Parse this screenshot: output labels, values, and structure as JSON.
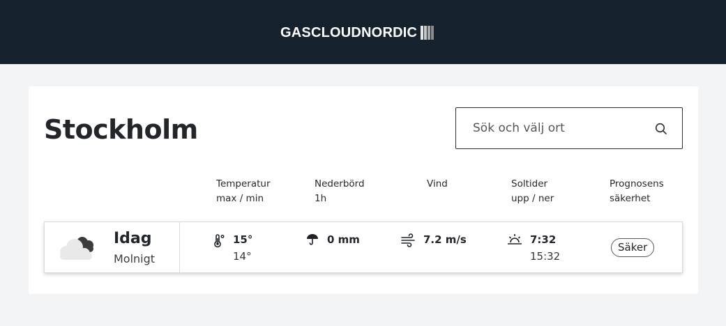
{
  "header": {
    "logo_text": "GASCLOUDNORDIC",
    "logo_bars": [
      "#e6e6e6",
      "#c8c8c8",
      "#a8a8a8",
      "#8a8a8a"
    ]
  },
  "location": {
    "name": "Stockholm"
  },
  "search": {
    "placeholder": "Sök och välj ort",
    "value": ""
  },
  "columns": [
    {
      "line1": "Temperatur",
      "line2": "max / min"
    },
    {
      "line1": "Nederbörd",
      "line2": "1h"
    },
    {
      "line1": "Vind",
      "line2": ""
    },
    {
      "line1": "Soltider",
      "line2": "upp / ner"
    },
    {
      "line1": "Prognosens",
      "line2": "säkerhet"
    }
  ],
  "forecast": [
    {
      "day": "Idag",
      "condition": "Molnigt",
      "icon": "cloudy-icon",
      "temp_max": "15°",
      "temp_min": "14°",
      "precipitation": "0 mm",
      "wind": "7.2 m/s",
      "sunrise": "7:32",
      "sunset": "15:32",
      "certainty": "Säker"
    }
  ],
  "colors": {
    "header_bg": "#15222e",
    "page_bg": "#f3f4f6",
    "card_bg": "#ffffff",
    "text": "#22262a"
  }
}
